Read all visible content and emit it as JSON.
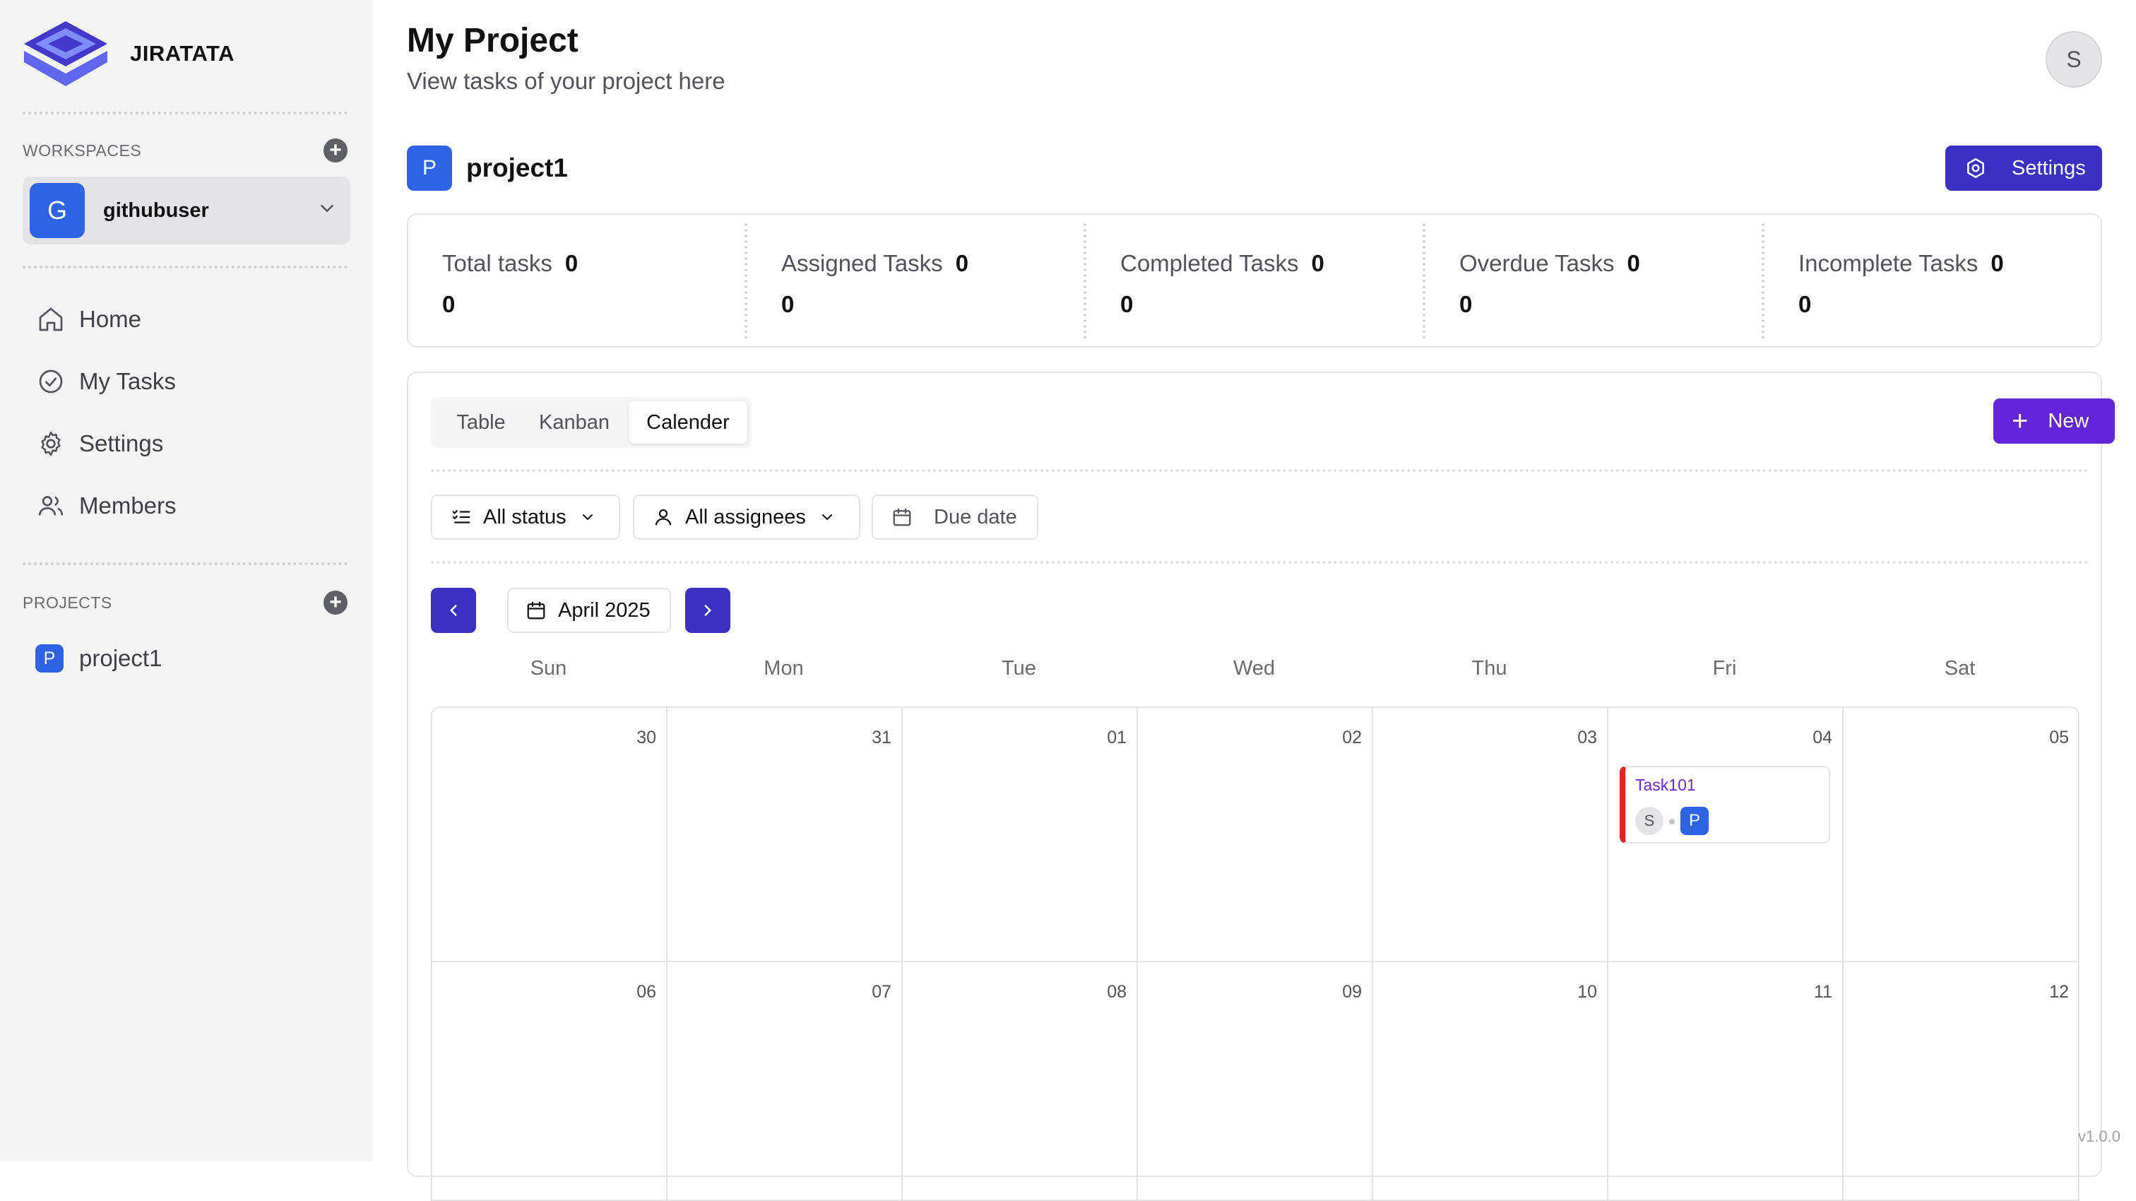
{
  "app": {
    "name": "JIRATATA",
    "version": "v1.0.0"
  },
  "sidebar": {
    "workspaces_label": "WORKSPACES",
    "workspace": {
      "initial": "G",
      "name": "githubuser"
    },
    "nav": [
      {
        "label": "Home",
        "icon": "home-icon"
      },
      {
        "label": "My Tasks",
        "icon": "check-circle-icon"
      },
      {
        "label": "Settings",
        "icon": "gear-icon"
      },
      {
        "label": "Members",
        "icon": "users-icon"
      }
    ],
    "projects_label": "PROJECTS",
    "projects": [
      {
        "initial": "P",
        "name": "project1"
      }
    ]
  },
  "header": {
    "title": "My Project",
    "subtitle": "View tasks of your project here",
    "user_initial": "S"
  },
  "project": {
    "initial": "P",
    "name": "project1",
    "settings_label": "Settings"
  },
  "stats": [
    {
      "label": "Total tasks",
      "badge": "0",
      "value": "0"
    },
    {
      "label": "Assigned Tasks",
      "badge": "0",
      "value": "0"
    },
    {
      "label": "Completed Tasks",
      "badge": "0",
      "value": "0"
    },
    {
      "label": "Overdue Tasks",
      "badge": "0",
      "value": "0"
    },
    {
      "label": "Incomplete Tasks",
      "badge": "0",
      "value": "0"
    }
  ],
  "view": {
    "tabs": [
      "Table",
      "Kanban",
      "Calender"
    ],
    "active_tab": "Calender",
    "new_label": "New",
    "filters": {
      "status": "All status",
      "assignees": "All assignees",
      "due_date": "Due date"
    }
  },
  "calendar": {
    "month": "April 2025",
    "weekdays": [
      "Sun",
      "Mon",
      "Tue",
      "Wed",
      "Thu",
      "Fri",
      "Sat"
    ],
    "weeks": [
      [
        "30",
        "31",
        "01",
        "02",
        "03",
        "04",
        "05"
      ],
      [
        "06",
        "07",
        "08",
        "09",
        "10",
        "11",
        "12"
      ]
    ],
    "tasks": [
      {
        "week": 0,
        "day": 5,
        "name": "Task101",
        "assignee_initial": "S",
        "project_initial": "P",
        "accent": "#dc2626"
      }
    ]
  },
  "colors": {
    "primary": "#3c2fc3",
    "new_button": "#6226d9",
    "project_blue": "#2f63e6"
  }
}
